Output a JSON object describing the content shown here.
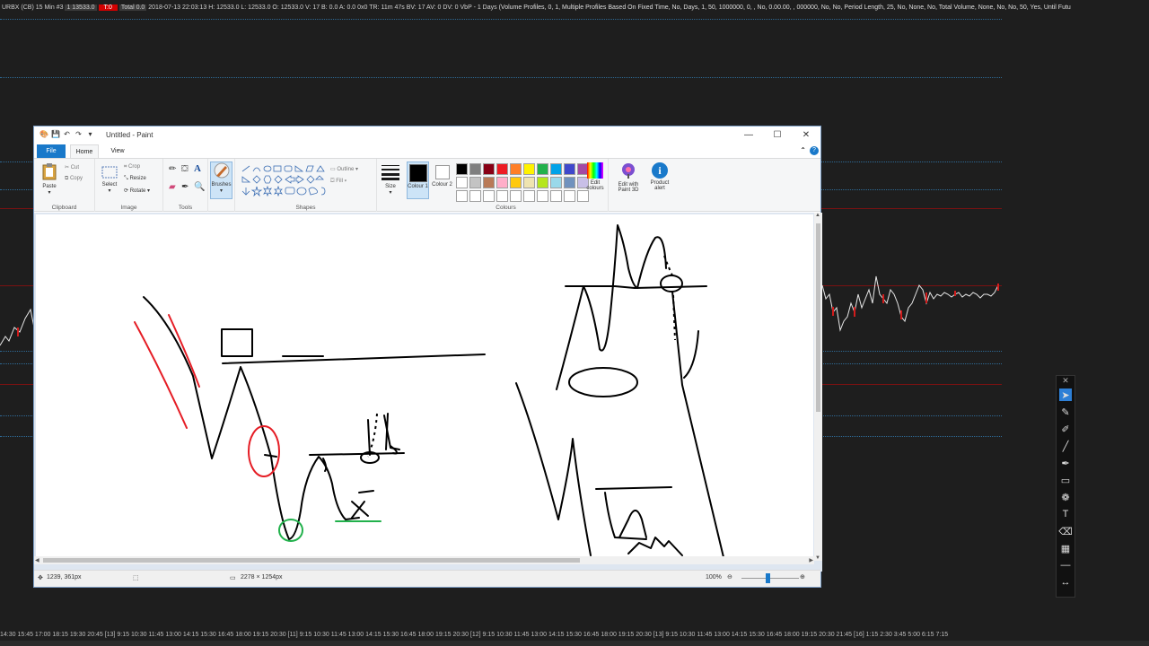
{
  "chart": {
    "header_left": "URBX (CB) 15 Min",
    "header_code1": "#3",
    "header_code2": "1 13533.0",
    "header_red": "T:0",
    "header_code3": "Total 0.0",
    "header_stats": "2018-07-13 22:03:13 H: 12533.0 L: 12533.0 O: 12533.0 V: 17 B: 0.0 A: 0.0 0x0 TR: 11m 47s BV: 17 AV: 0 DV: 0 VbP - 1 Days",
    "header_study": "(Volume Profiles, 0, 1, Multiple Profiles Based On Fixed Time, No, Days, 1, 50, 1000000, 0, , No, 0.00.00, , 000000, No, No, Period Length, 25, No, None, No, Total Volume, None, No, No, 50, Yes, Until Futu",
    "time_labels": "14:30  15:45  17:00  18:15  19:30  20:45  [13]  9:15  10:30  11:45  13:00  14:15  15:30  16:45  18:00  19:15  20:30  [11]  9:15  10:30  11:45  13:00  14:15  15:30  16:45  18:00  19:15  20:30  [12]  9:15  10:30  11:45  13:00  14:15  15:30  16:45  18:00  19:15  20:30  [13]  9:15  10:30  11:45  13:00  14:15  15:30  16:45  18:00  19:15  20:30  21:45  [16]  1:15  2:30  3:45  5:00  6:15  7:15"
  },
  "paint": {
    "title": "Untitled - Paint",
    "tabs": {
      "file": "File",
      "home": "Home",
      "view": "View"
    },
    "clipboard": {
      "paste": "Paste",
      "cut": "Cut",
      "copy": "Copy",
      "label": "Clipboard"
    },
    "image": {
      "select": "Select",
      "crop": "Crop",
      "resize": "Resize",
      "rotate": "Rotate",
      "label": "Image"
    },
    "tools": {
      "label": "Tools"
    },
    "brushes": {
      "label": "Brushes"
    },
    "shapes": {
      "label": "Shapes",
      "outline": "Outline",
      "fill": "Fill"
    },
    "size": {
      "label": "Size"
    },
    "colours": {
      "colour1": "Colour 1",
      "colour2": "Colour 2",
      "label": "Colours",
      "edit": "Edit colours",
      "paint3d": "Edit with Paint 3D",
      "alert": "Product alert",
      "palette_row1": [
        "#000000",
        "#7f7f7f",
        "#880015",
        "#ed1c24",
        "#ff7f27",
        "#fff200",
        "#22b14c",
        "#00a2e8",
        "#3f48cc",
        "#a349a4"
      ],
      "palette_row2": [
        "#ffffff",
        "#c3c3c3",
        "#b97a57",
        "#ffaec9",
        "#ffc90e",
        "#efe4b0",
        "#b5e61d",
        "#99d9ea",
        "#7092be",
        "#c8bfe7"
      ]
    },
    "status": {
      "cursor": "1239, 361px",
      "dimensions": "2278 × 1254px",
      "zoom": "100%"
    }
  }
}
